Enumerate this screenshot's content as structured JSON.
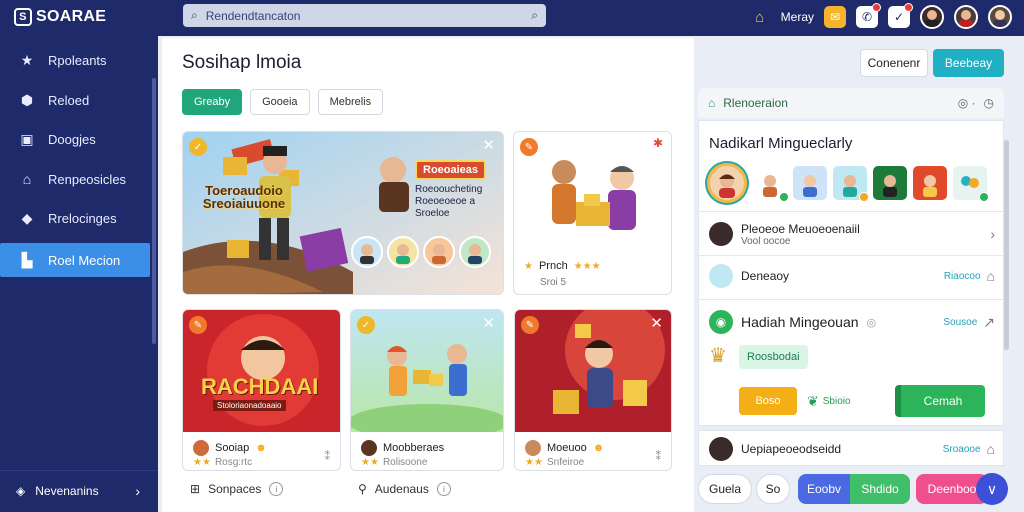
{
  "app": {
    "logo": "SOARAE"
  },
  "search": {
    "text": "Rendendtancaton"
  },
  "topbar": {
    "user_label": "Meray"
  },
  "sidebar": {
    "items": [
      {
        "label": "Rpoleants",
        "icon": "star-icon"
      },
      {
        "label": "Reloed",
        "icon": "shield-icon"
      },
      {
        "label": "Doogjes",
        "icon": "gallery-icon"
      },
      {
        "label": "Renpeosicles",
        "icon": "home-icon"
      },
      {
        "label": "Rrelocinges",
        "icon": "tag-icon"
      },
      {
        "label": "Roel Mecion",
        "icon": "bookmark-icon"
      }
    ],
    "bottom_label": "Nevenanins"
  },
  "main": {
    "title": "Sosihap lmoia",
    "filters": [
      "Greaby",
      "Gooeia",
      "Mebrelis"
    ],
    "hero": {
      "banner_text": "Toeroaudoio Sreoiaiuuone",
      "label": "Roeoaieas",
      "sub1": "Roeooucheting",
      "sub2": "Roeoeoeoe a",
      "sub3": "Sroeloe"
    },
    "side_card": {
      "title": "Prnch",
      "sub": "Sroi 5"
    },
    "card_banner": "RACHDAAI",
    "card_banner_sub": "Stoloriaonadoaaio",
    "cards": [
      {
        "title": "Sooiap",
        "meta": "Rosg:rtc"
      },
      {
        "title": "Moobberaes",
        "meta": "Rolisoone"
      },
      {
        "title": "Moeuoo",
        "meta": "Snfeiroe"
      }
    ],
    "bottom_links": [
      "Sonpaces",
      "Audenaus"
    ]
  },
  "right": {
    "btn_outline": "Conenenr",
    "btn_primary": "Beebeay",
    "panel_head": "Rlenoeraion",
    "panel_title": "Nadikarl Mingueclarly",
    "rows": [
      {
        "title": "Pleoeoe Meuoeoenaiil",
        "sub": "Vool oocoe"
      },
      {
        "title": "Deneaoy",
        "side": "Riaocoo"
      },
      {
        "title": "Hadiah Mingeouan",
        "side": "Sousoe"
      }
    ],
    "pill": "Roosbodai",
    "btn_yellow": "Boso",
    "mid_label": "Sbioio",
    "btn_green": "Cemah",
    "row_bottom": {
      "title": "Uepiapeoeodseidd",
      "side": "Sroaooe"
    },
    "bottom_buttons": [
      "Guela",
      "So",
      "Eoobv",
      "Shdido",
      "Deenboo"
    ]
  },
  "colors": {
    "sidebar": "#1f2a6b",
    "active": "#3b8fe6",
    "accent_green": "#1fa67a",
    "accent_teal": "#1fb0c4"
  }
}
